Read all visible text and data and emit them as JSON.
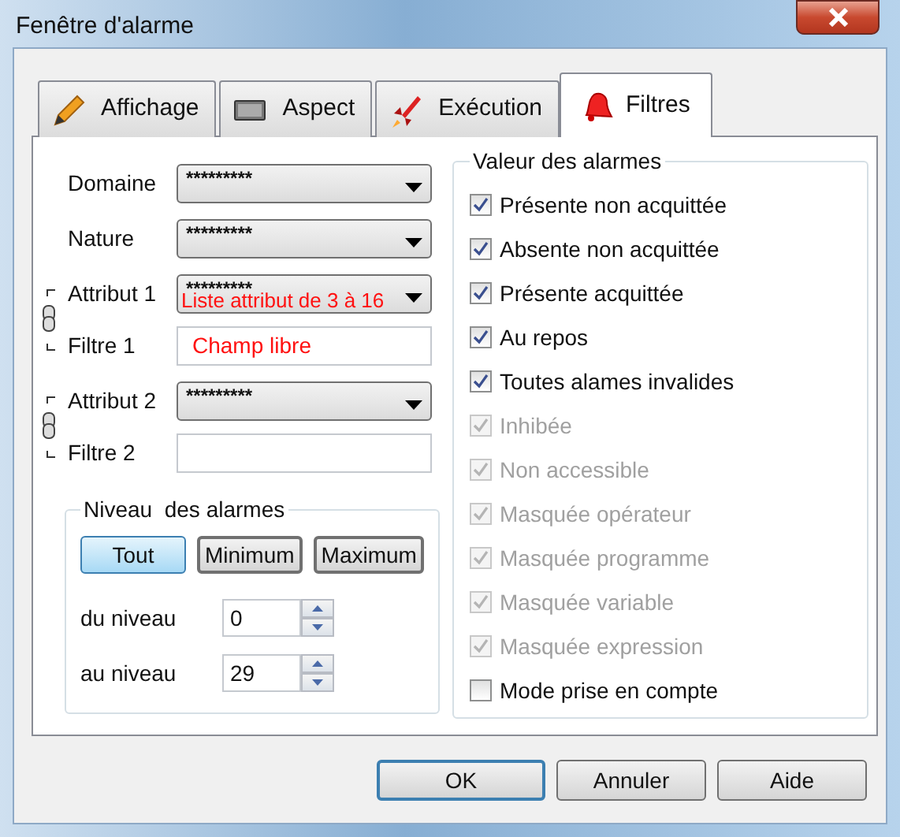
{
  "window": {
    "title": "Fenêtre d'alarme"
  },
  "tabs": [
    {
      "label": "Affichage",
      "kind": "pencil",
      "selected": false
    },
    {
      "label": "Aspect",
      "kind": "screen",
      "selected": false
    },
    {
      "label": "Exécution",
      "kind": "rocket",
      "selected": false
    },
    {
      "label": "Filtres",
      "kind": "bell",
      "selected": true
    }
  ],
  "criteria": [
    {
      "linked": false,
      "fields": [
        {
          "label": "Domaine",
          "kind": "combo",
          "value": "*********"
        }
      ]
    },
    {
      "linked": false,
      "fields": [
        {
          "label": "Nature",
          "kind": "combo",
          "value": "*********"
        }
      ]
    },
    {
      "linked": true,
      "fields": [
        {
          "label": "Attribut 1",
          "kind": "combo",
          "value": "*********",
          "annotation": "Liste attribut de 3 à 16"
        },
        {
          "label": "Filtre 1",
          "kind": "text",
          "annotation": "Champ libre"
        }
      ]
    },
    {
      "linked": true,
      "fields": [
        {
          "label": "Attribut 2",
          "kind": "combo",
          "value": "*********"
        },
        {
          "label": "Filtre 2",
          "kind": "text"
        }
      ]
    }
  ],
  "level_group": {
    "title": "Niveau  des alarmes",
    "buttons": [
      {
        "label": "Tout",
        "selected": true
      },
      {
        "label": "Minimum",
        "selected": false
      },
      {
        "label": "Maximum",
        "selected": false
      }
    ],
    "spins": [
      {
        "label": "du niveau",
        "value": "0"
      },
      {
        "label": "au niveau",
        "value": "29"
      }
    ]
  },
  "values_group": {
    "title": "Valeur des alarmes",
    "items": [
      {
        "label": "Présente non acquittée",
        "checked": true,
        "disabled": false
      },
      {
        "label": "Absente non acquittée",
        "checked": true,
        "disabled": false
      },
      {
        "label": "Présente acquittée",
        "checked": true,
        "disabled": false
      },
      {
        "label": "Au repos",
        "checked": true,
        "disabled": false
      },
      {
        "label": "Toutes alames invalides",
        "checked": true,
        "disabled": false
      },
      {
        "label": "Inhibée",
        "checked": true,
        "disabled": true
      },
      {
        "label": "Non accessible",
        "checked": true,
        "disabled": true
      },
      {
        "label": "Masquée opérateur",
        "checked": true,
        "disabled": true
      },
      {
        "label": "Masquée programme",
        "checked": true,
        "disabled": true
      },
      {
        "label": "Masquée variable",
        "checked": true,
        "disabled": true
      },
      {
        "label": "Masquée expression",
        "checked": true,
        "disabled": true
      },
      {
        "label": "Mode prise en compte",
        "checked": false,
        "disabled": false
      }
    ]
  },
  "buttons": [
    {
      "label": "OK",
      "default": true
    },
    {
      "label": "Annuler",
      "default": false
    },
    {
      "label": "Aide",
      "default": false
    }
  ]
}
